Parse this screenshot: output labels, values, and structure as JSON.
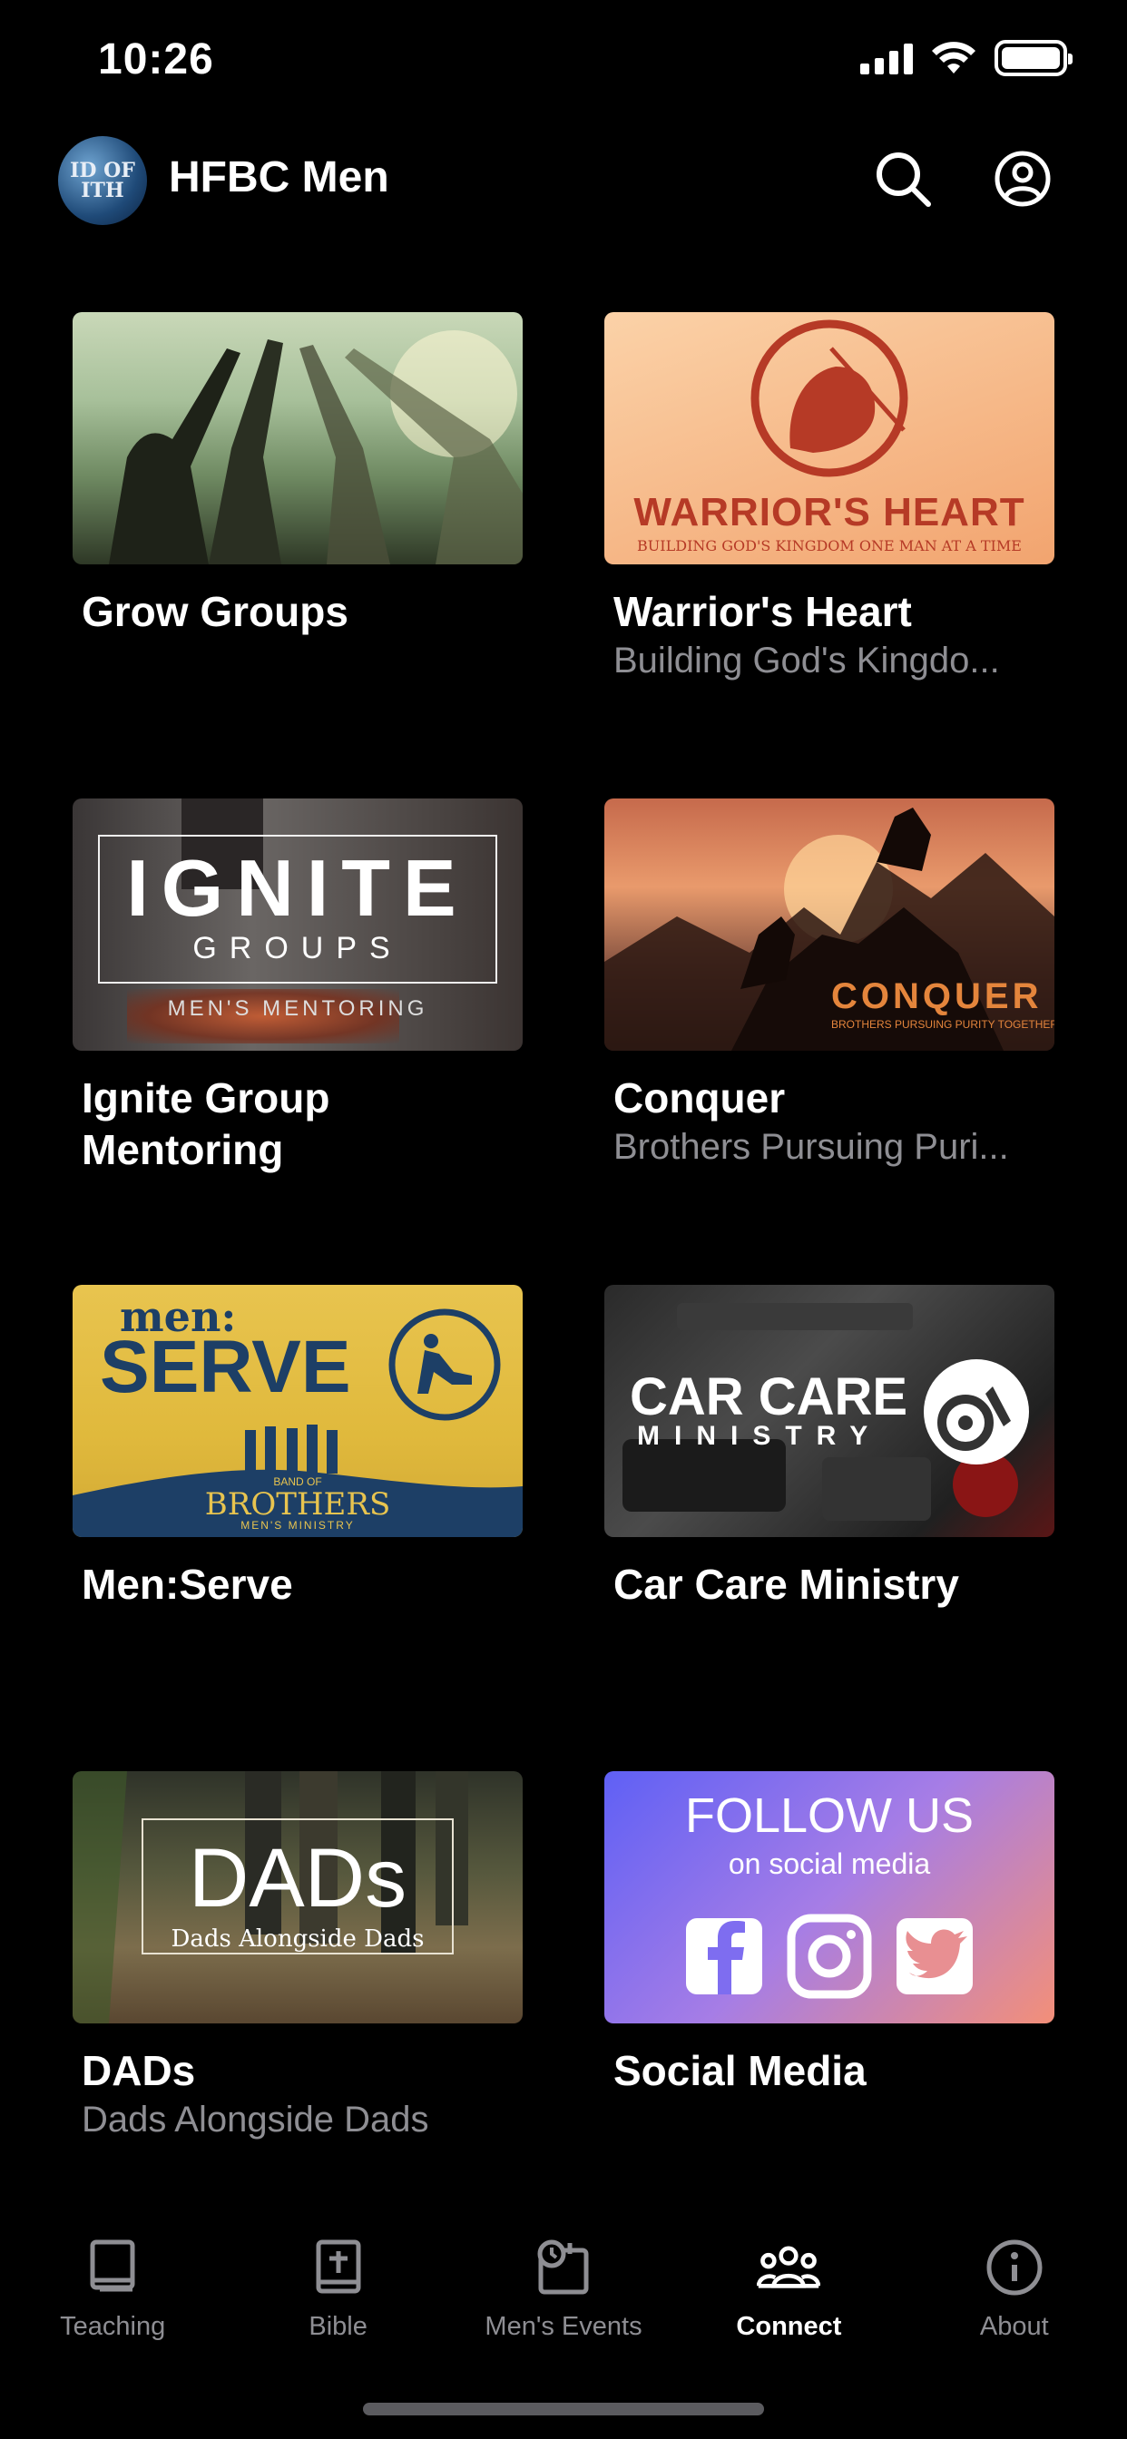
{
  "status": {
    "time": "10:26"
  },
  "header": {
    "title": "HFBC Men",
    "logo_text": "ID OF\nITH"
  },
  "cards": [
    {
      "title": "Grow Groups",
      "subtitle": ""
    },
    {
      "title": "Warrior's Heart",
      "subtitle": "Building God's Kingdo...",
      "thumb_title": "WARRIOR'S HEART",
      "thumb_sub": "BUILDING GOD'S KINGDOM ONE MAN AT A TIME"
    },
    {
      "title": "Ignite Group Mentoring",
      "subtitle": "",
      "thumb_title": "IGNITE",
      "thumb_sub": "GROUPS",
      "thumb_sub2": "MEN'S MENTORING"
    },
    {
      "title": "Conquer",
      "subtitle": "Brothers Pursuing Puri...",
      "thumb_title": "CONQUER",
      "thumb_sub": "BROTHERS PURSUING PURITY TOGETHER"
    },
    {
      "title": "Men:Serve",
      "subtitle": "",
      "thumb_title": "men:",
      "thumb_sub": "SERVE",
      "thumb_sub2": "BAND OF",
      "thumb_sub3": "BROTHERS",
      "thumb_sub4": "MEN'S MINISTRY"
    },
    {
      "title": "Car Care Ministry",
      "subtitle": "",
      "thumb_title": "CAR CARE",
      "thumb_sub": "MINISTRY"
    },
    {
      "title": "DADs",
      "subtitle": "Dads Alongside Dads",
      "thumb_title": "DADs",
      "thumb_sub": "Dads Alongside Dads"
    },
    {
      "title": "Social Media",
      "subtitle": "",
      "thumb_title": "FOLLOW US",
      "thumb_sub": "on social media"
    }
  ],
  "tabs": [
    {
      "label": "Teaching",
      "icon": "book-icon"
    },
    {
      "label": "Bible",
      "icon": "bible-icon"
    },
    {
      "label": "Men's Events",
      "icon": "calendar-icon"
    },
    {
      "label": "Connect",
      "icon": "people-icon",
      "active": true
    },
    {
      "label": "About",
      "icon": "info-icon"
    }
  ],
  "colors": {
    "background": "#000000",
    "active_tab": "#ffffff",
    "inactive_tab": "#8e8e93",
    "subtitle": "#8e8e93"
  }
}
